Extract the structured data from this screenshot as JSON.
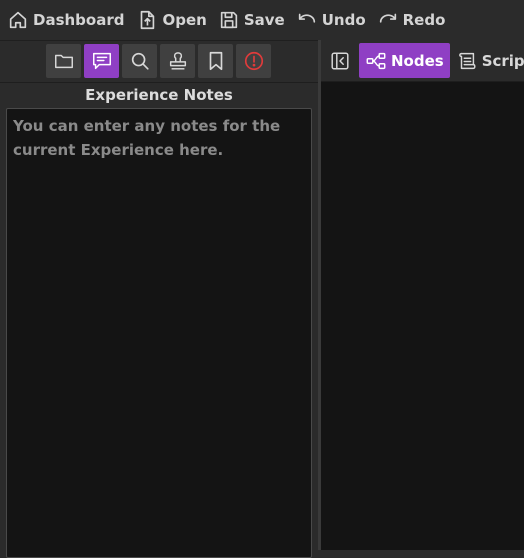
{
  "toolbar": {
    "dashboard": "Dashboard",
    "open": "Open",
    "save": "Save",
    "undo": "Undo",
    "redo": "Redo"
  },
  "left_panel": {
    "tools": [
      {
        "name": "files",
        "icon": "folder-icon",
        "active": false
      },
      {
        "name": "notes",
        "icon": "notes-icon",
        "active": true
      },
      {
        "name": "search",
        "icon": "search-icon",
        "active": false
      },
      {
        "name": "stamp",
        "icon": "stamp-icon",
        "active": false
      },
      {
        "name": "bookmarks",
        "icon": "bookmark-icon",
        "active": false
      },
      {
        "name": "errors",
        "icon": "alert-icon",
        "active": false
      }
    ],
    "notes_title": "Experience Notes",
    "notes_placeholder": "You can enter any notes for the current Experience here.",
    "notes_value": ""
  },
  "right_panel": {
    "tabs": [
      {
        "label": "Nodes",
        "icon": "nodes-icon",
        "active": true
      },
      {
        "label": "Script",
        "icon": "script-icon",
        "active": false
      }
    ]
  },
  "colors": {
    "accent": "#8f3fc4",
    "background": "#2b2b2b",
    "editor_bg": "#141414",
    "alert": "#e03b3b"
  }
}
